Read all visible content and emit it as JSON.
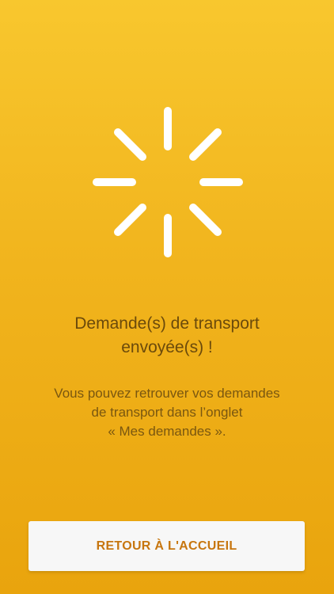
{
  "status": {
    "title_line1": "Demande(s) de transport",
    "title_line2": "envoyée(s) !",
    "message_line1": "Vous pouvez retrouver vos demandes",
    "message_line2": "de transport dans l’onglet",
    "message_line3": "« Mes demandes »."
  },
  "actions": {
    "home_label": "RETOUR À L'ACCUEIL"
  },
  "icons": {
    "spinner": "loading-spinner-icon"
  },
  "colors": {
    "background_top": "#f8c72e",
    "background_bottom": "#e9a40d",
    "text": "#6b4a0b",
    "button_text": "#c7760f",
    "button_bg": "#f7f7f7"
  }
}
